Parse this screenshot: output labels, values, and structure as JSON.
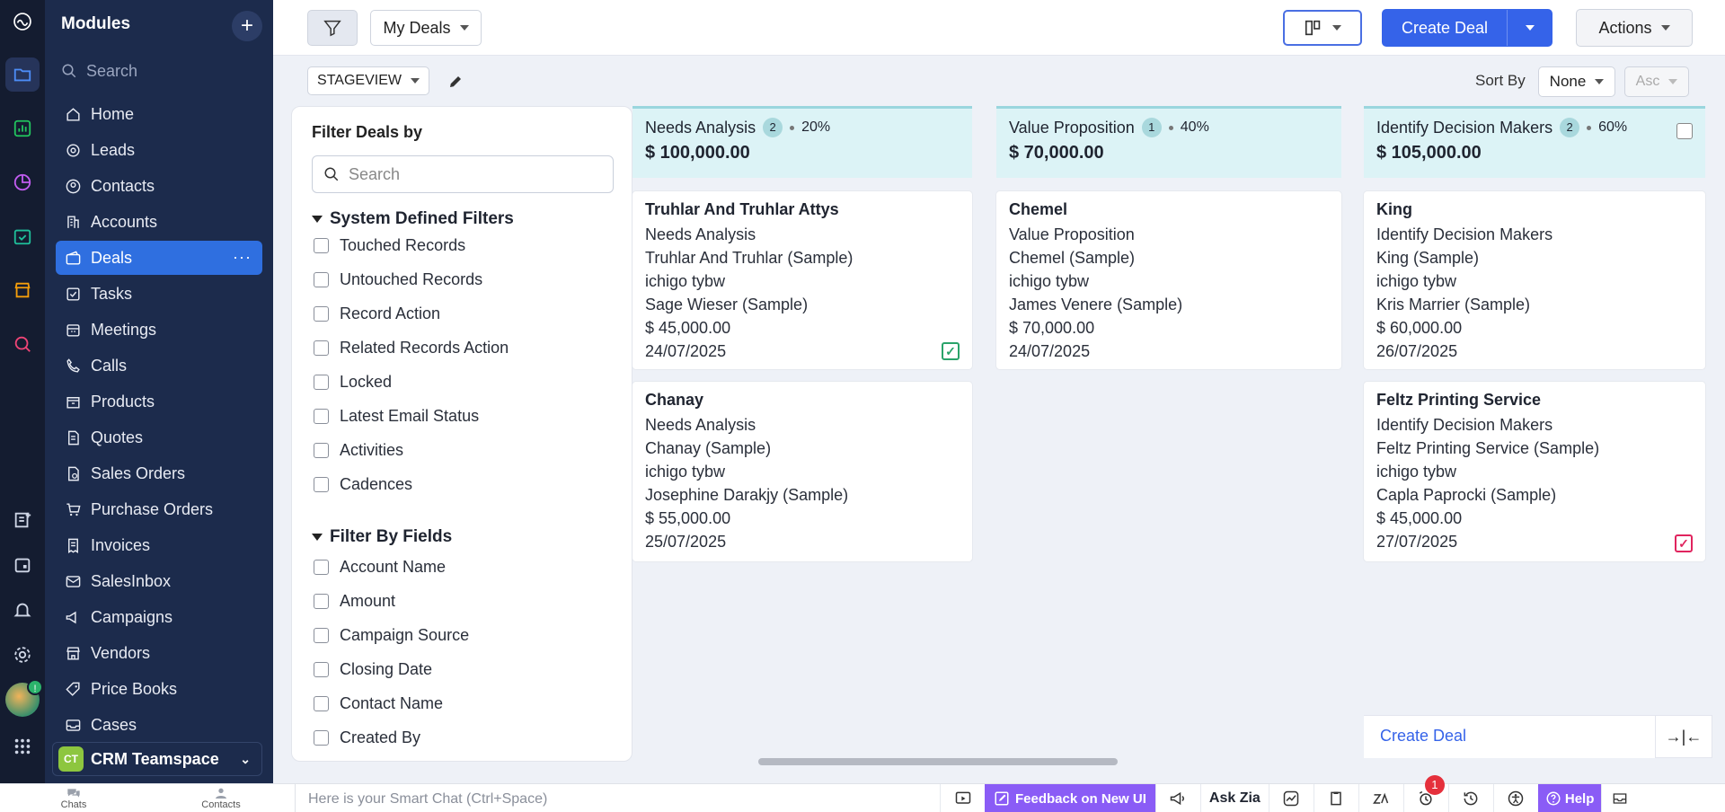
{
  "sidebar": {
    "title": "Modules",
    "search_placeholder": "Search",
    "items": [
      {
        "label": "Home",
        "icon": "home-icon"
      },
      {
        "label": "Leads",
        "icon": "leads-icon"
      },
      {
        "label": "Contacts",
        "icon": "contacts-icon"
      },
      {
        "label": "Accounts",
        "icon": "accounts-icon"
      },
      {
        "label": "Deals",
        "icon": "deals-icon",
        "active": true
      },
      {
        "label": "Tasks",
        "icon": "tasks-icon"
      },
      {
        "label": "Meetings",
        "icon": "meetings-icon"
      },
      {
        "label": "Calls",
        "icon": "calls-icon"
      },
      {
        "label": "Products",
        "icon": "products-icon"
      },
      {
        "label": "Quotes",
        "icon": "quotes-icon"
      },
      {
        "label": "Sales Orders",
        "icon": "sales-orders-icon"
      },
      {
        "label": "Purchase Orders",
        "icon": "purchase-orders-icon"
      },
      {
        "label": "Invoices",
        "icon": "invoices-icon"
      },
      {
        "label": "SalesInbox",
        "icon": "salesinbox-icon"
      },
      {
        "label": "Campaigns",
        "icon": "campaigns-icon"
      },
      {
        "label": "Vendors",
        "icon": "vendors-icon"
      },
      {
        "label": "Price Books",
        "icon": "price-books-icon"
      },
      {
        "label": "Cases",
        "icon": "cases-icon"
      }
    ],
    "team_initials": "CT",
    "team_name": "CRM Teamspace"
  },
  "topbar": {
    "view_name": "My Deals",
    "create_label": "Create Deal",
    "actions_label": "Actions"
  },
  "subbar": {
    "stageview_label": "STAGEVIEW",
    "sort_by_label": "Sort By",
    "sort_field": "None",
    "sort_order": "Asc"
  },
  "filter_panel": {
    "title": "Filter Deals by",
    "search_placeholder": "Search",
    "system_section": "System Defined Filters",
    "system_filters": [
      "Touched Records",
      "Untouched Records",
      "Record Action",
      "Related Records Action",
      "Locked",
      "Latest Email Status",
      "Activities",
      "Cadences"
    ],
    "fields_section": "Filter By Fields",
    "field_filters": [
      "Account Name",
      "Amount",
      "Campaign Source",
      "Closing Date",
      "Contact Name",
      "Created By"
    ]
  },
  "columns": [
    {
      "name": "Needs Analysis",
      "count": "2",
      "percent": "20%",
      "amount": "$ 100,000.00",
      "cards": [
        {
          "title": "Truhlar And Truhlar Attys",
          "lines": [
            "Needs Analysis",
            "Truhlar And Truhlar (Sample)",
            "ichigo tybw",
            "Sage Wieser (Sample)",
            "$ 45,000.00",
            "24/07/2025"
          ],
          "task": "ok"
        },
        {
          "title": "Chanay",
          "lines": [
            "Needs Analysis",
            "Chanay (Sample)",
            "ichigo tybw",
            "Josephine Darakjy (Sample)",
            "$ 55,000.00",
            "25/07/2025"
          ],
          "task": ""
        }
      ]
    },
    {
      "name": "Value Proposition",
      "count": "1",
      "percent": "40%",
      "amount": "$ 70,000.00",
      "cards": [
        {
          "title": "Chemel",
          "lines": [
            "Value Proposition",
            "Chemel (Sample)",
            "ichigo tybw",
            "James Venere (Sample)",
            "$ 70,000.00",
            "24/07/2025"
          ],
          "task": ""
        }
      ]
    },
    {
      "name": "Identify Decision Makers",
      "count": "2",
      "percent": "60%",
      "amount": "$ 105,000.00",
      "cards": [
        {
          "title": "King",
          "lines": [
            "Identify Decision Makers",
            "King (Sample)",
            "ichigo tybw",
            "Kris Marrier (Sample)",
            "$ 60,000.00",
            "26/07/2025"
          ],
          "task": ""
        },
        {
          "title": "Feltz Printing Service",
          "lines": [
            "Identify Decision Makers",
            "Feltz Printing Service (Sample)",
            "ichigo tybw",
            "Capla Paprocki (Sample)",
            "$ 45,000.00",
            "27/07/2025"
          ],
          "task": "due"
        }
      ]
    }
  ],
  "board": {
    "create_deal_link": "Create Deal",
    "collapse_glyph": "→|←"
  },
  "bottombar": {
    "chats_label": "Chats",
    "contacts_label": "Contacts",
    "smart_chat_placeholder": "Here is your Smart Chat (Ctrl+Space)",
    "feedback_label": "Feedback on New UI",
    "ask_zia_label": "Ask Zia",
    "alarm_count": "1",
    "help_label": "Help"
  },
  "colors": {
    "rail_bg": "#141c30",
    "sidebar_bg": "#1c2b4c",
    "active_item": "#2f6fe0",
    "primary_button": "#3563e9",
    "column_header_bg": "#dcf3f6",
    "feedback_bg": "#8a5cf6",
    "task_ok": "#2aa36a",
    "task_due": "#e0245e"
  }
}
